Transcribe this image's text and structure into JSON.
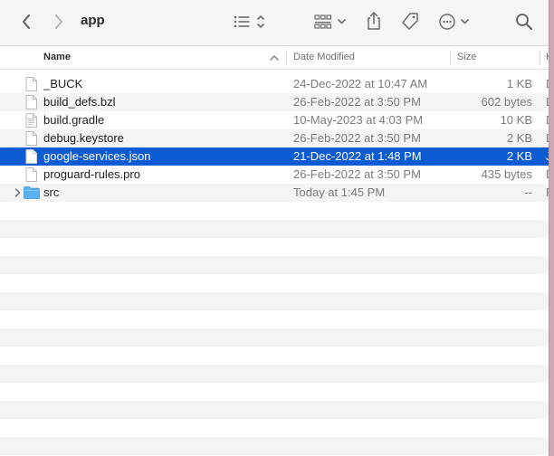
{
  "window": {
    "title": "app"
  },
  "toolbar": {
    "back_icon": "chevron-left-icon",
    "forward_icon": "chevron-right-icon",
    "view_icon": "list-view-icon",
    "group_icon": "grid-group-icon",
    "share_icon": "share-icon",
    "tag_icon": "tag-icon",
    "more_icon": "ellipsis-circle-icon",
    "search_icon": "search-icon"
  },
  "columns": {
    "name": "Name",
    "date": "Date Modified",
    "size": "Size",
    "kind": "K"
  },
  "colors": {
    "selection": "#0b5bd3",
    "folder": "#5ab2f0",
    "alt_row": "#f4f4f5"
  },
  "files": [
    {
      "name": "_BUCK",
      "date": "24-Dec-2022 at 10:47 AM",
      "size": "1 KB",
      "kind": "D",
      "icon": "document-icon",
      "selected": false
    },
    {
      "name": "build_defs.bzl",
      "date": "26-Feb-2022 at 3:50 PM",
      "size": "602 bytes",
      "kind": "D",
      "icon": "document-icon",
      "selected": false
    },
    {
      "name": "build.gradle",
      "date": "10-May-2023 at 4:03 PM",
      "size": "10 KB",
      "kind": "D",
      "icon": "text-document-icon",
      "selected": false
    },
    {
      "name": "debug.keystore",
      "date": "26-Feb-2022 at 3:50 PM",
      "size": "2 KB",
      "kind": "D",
      "icon": "document-icon",
      "selected": false
    },
    {
      "name": "google-services.json",
      "date": "21-Dec-2022 at 1:48 PM",
      "size": "2 KB",
      "kind": "J",
      "icon": "document-icon",
      "selected": true
    },
    {
      "name": "proguard-rules.pro",
      "date": "26-Feb-2022 at 3:50 PM",
      "size": "435 bytes",
      "kind": "D",
      "icon": "document-icon",
      "selected": false
    },
    {
      "name": "src",
      "date": "Today at 1:45 PM",
      "size": "--",
      "kind": "F",
      "icon": "folder-icon",
      "selected": false
    }
  ]
}
